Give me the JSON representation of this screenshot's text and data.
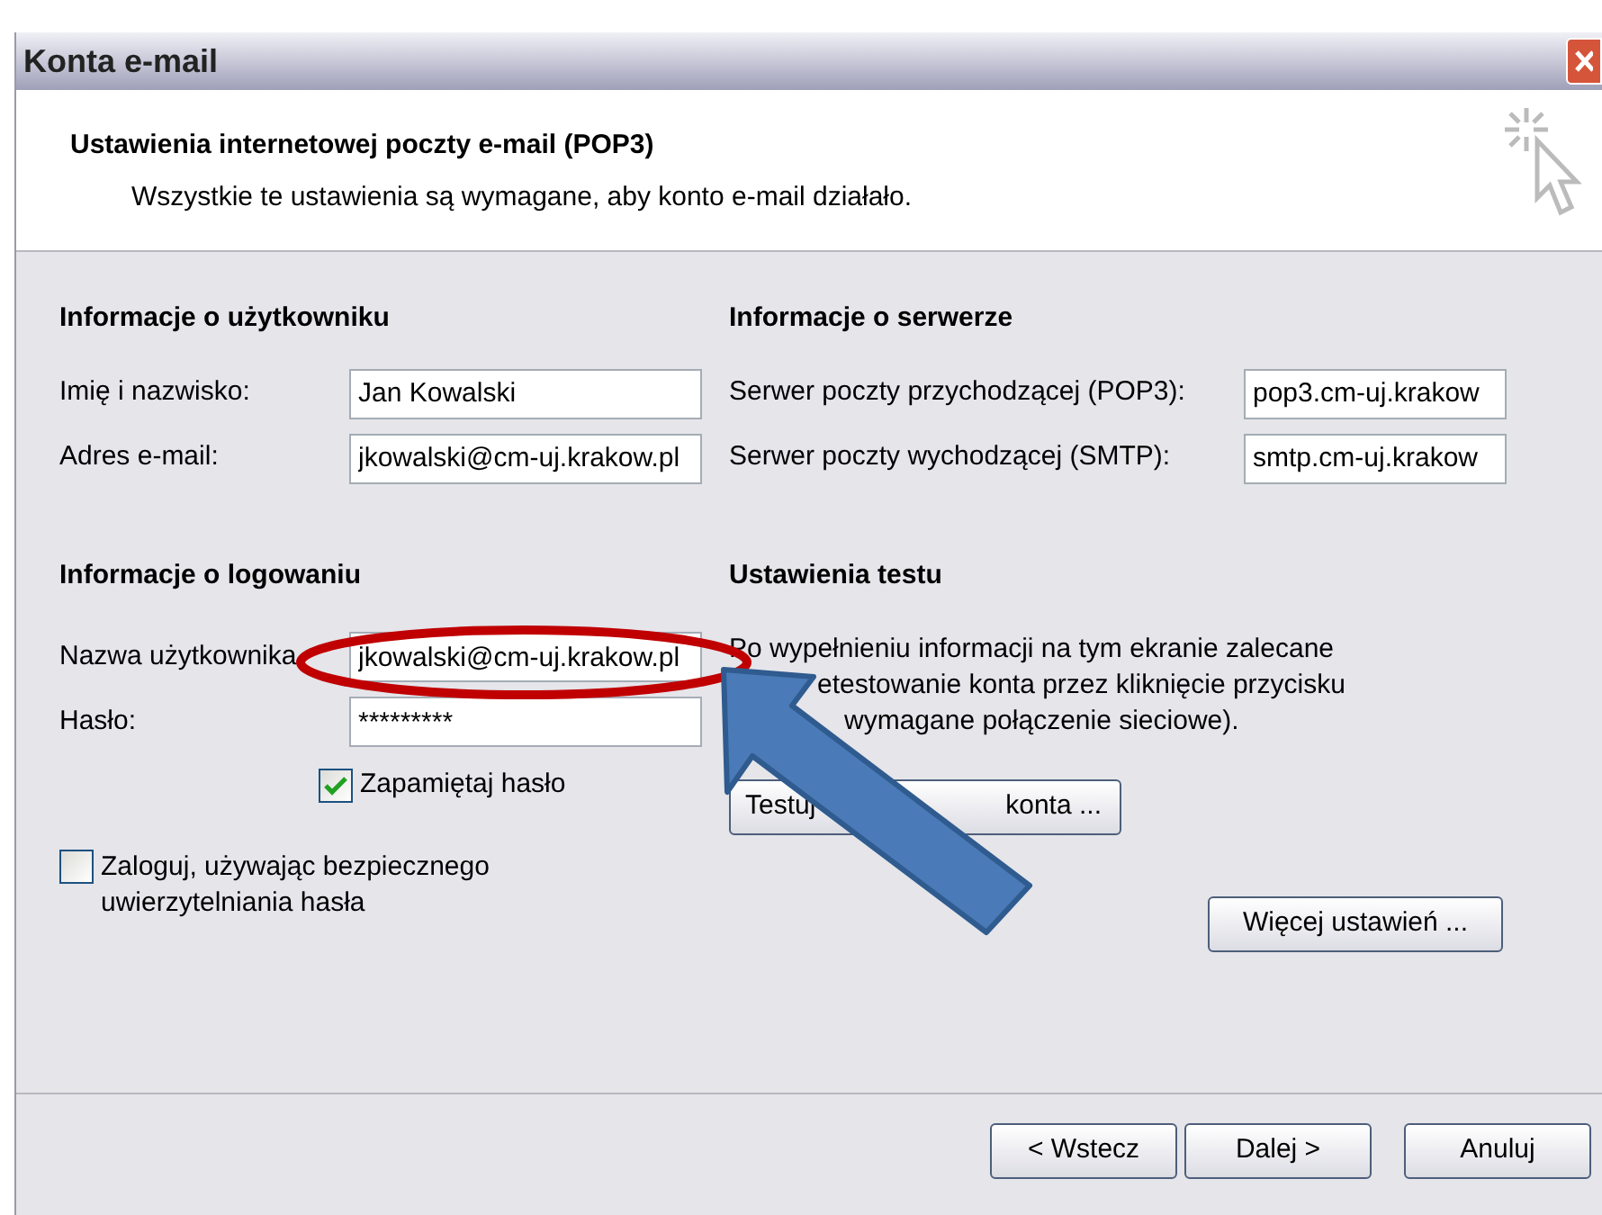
{
  "window": {
    "title": "Konta e-mail"
  },
  "header": {
    "title": "Ustawienia internetowej poczty e-mail (POP3)",
    "subtitle": "Wszystkie te ustawienia są wymagane, aby konto e-mail działało."
  },
  "user_info": {
    "heading": "Informacje o użytkowniku",
    "fields": [
      {
        "label": "Imię i nazwisko:",
        "value": "Jan Kowalski"
      },
      {
        "label": "Adres e-mail:",
        "value": "jkowalski@cm-uj.krakow.pl"
      }
    ]
  },
  "server_info": {
    "heading": "Informacje o serwerze",
    "fields": [
      {
        "label": "Serwer poczty przychodzącej (POP3):",
        "value": "pop3.cm-uj.krakow"
      },
      {
        "label": "Serwer poczty wychodzącej (SMTP):",
        "value": "smtp.cm-uj.krakow"
      }
    ]
  },
  "logon_info": {
    "heading": "Informacje o logowaniu",
    "fields": [
      {
        "label": "Nazwa użytkownika",
        "value": "jkowalski@cm-uj.krakow.pl"
      },
      {
        "label": "Hasło:",
        "value": "*********"
      }
    ],
    "remember_password": {
      "label": "Zapamiętaj hasło",
      "checked": true
    },
    "secure_auth": {
      "label": "Zaloguj, używając bezpiecznego uwierzytelniania hasła",
      "checked": false
    }
  },
  "test_settings": {
    "heading": "Ustawienia testu",
    "text_lines": [
      "Po wypełnieniu informacji na tym ekranie zalecane",
      "etestowanie konta przez kliknięcie przycisku",
      "wymagane połączenie sieciowe)."
    ],
    "test_button": [
      "Testuj",
      "konta ..."
    ]
  },
  "more_settings_button": "Więcej ustawień ...",
  "buttons": [
    "< Wstecz",
    "Dalej >",
    "Anuluj"
  ]
}
